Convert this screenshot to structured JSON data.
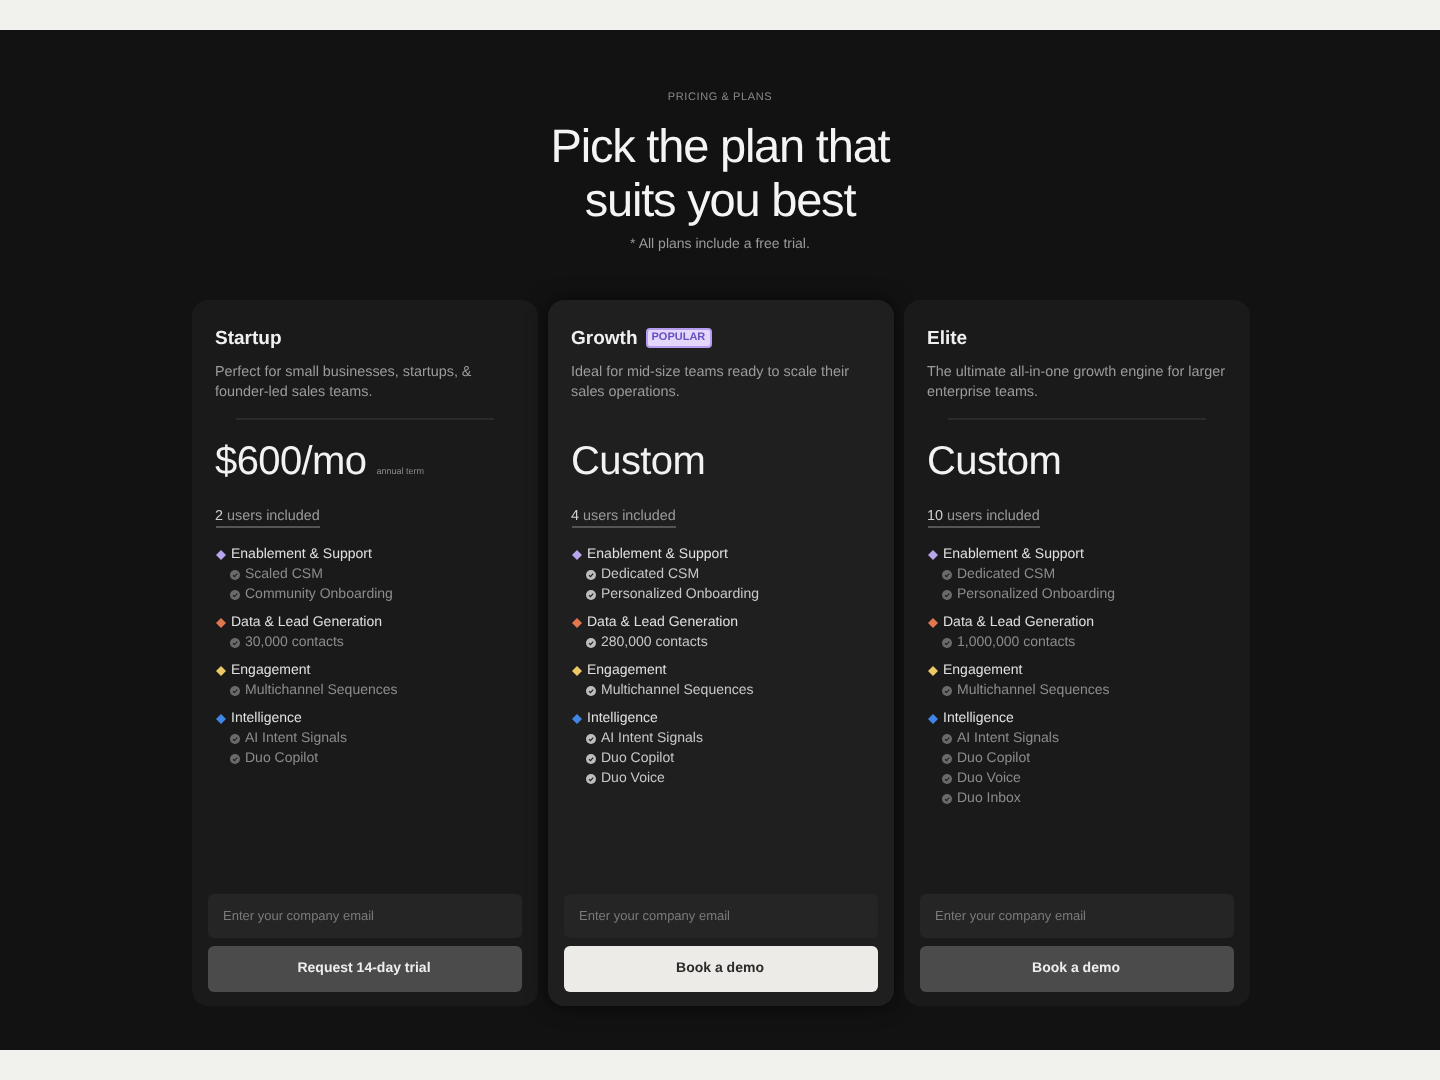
{
  "header": {
    "eyebrow": "PRICING & PLANS",
    "headline_lines": [
      "Pick the plan that",
      "suits you best"
    ],
    "note": "* All plans include a free trial."
  },
  "plans": [
    {
      "name": "Startup",
      "featured": false,
      "description": "Perfect for small businesses, startups, & founder-led sales teams.",
      "price": "$600/mo",
      "price_note": "annual term",
      "users": "**2** users included",
      "groups": [
        {
          "title": "Enablement & Support",
          "color": "#b6a4ec",
          "items": [
            "Scaled CSM",
            "Community Onboarding"
          ]
        },
        {
          "title": "Data & Lead Generation",
          "color": "#e0774f",
          "items": [
            "30,000 contacts"
          ]
        },
        {
          "title": "Engagement",
          "color": "#ecc866",
          "items": [
            "Multichannel Sequences"
          ]
        },
        {
          "title": "Intelligence",
          "color": "#3f86e6",
          "items": [
            "AI Intent Signals",
            "Duo Copilot"
          ]
        }
      ],
      "email_placeholder": "Enter your company email",
      "button": "Request 14-day trial"
    },
    {
      "name": "Growth",
      "badge": "POPULAR",
      "featured": true,
      "description": "Ideal for mid-size teams ready to scale their sales operations.",
      "price": "Custom",
      "users": "**4** users included",
      "groups": [
        {
          "title": "Enablement & Support",
          "color": "#b6a4ec",
          "items": [
            "Dedicated CSM",
            "Personalized Onboarding"
          ]
        },
        {
          "title": "Data & Lead Generation",
          "color": "#e0774f",
          "items": [
            "280,000 contacts"
          ]
        },
        {
          "title": "Engagement",
          "color": "#ecc866",
          "items": [
            "Multichannel Sequences"
          ]
        },
        {
          "title": "Intelligence",
          "color": "#3f86e6",
          "items": [
            "AI Intent Signals",
            "Duo Copilot",
            "Duo Voice"
          ]
        }
      ],
      "email_placeholder": "Enter your company email",
      "button": "Book a demo"
    },
    {
      "name": "Elite",
      "featured": false,
      "description": "The ultimate all-in-one growth engine for larger enterprise teams.",
      "price": "Custom",
      "users": "**10** users included",
      "groups": [
        {
          "title": "Enablement & Support",
          "color": "#b6a4ec",
          "items": [
            "Dedicated CSM",
            "Personalized Onboarding"
          ]
        },
        {
          "title": "Data & Lead Generation",
          "color": "#e0774f",
          "items": [
            "1,000,000 contacts"
          ]
        },
        {
          "title": "Engagement",
          "color": "#ecc866",
          "items": [
            "Multichannel Sequences"
          ]
        },
        {
          "title": "Intelligence",
          "color": "#3f86e6",
          "items": [
            "AI Intent Signals",
            "Duo Copilot",
            "Duo Voice",
            "Duo Inbox"
          ]
        }
      ],
      "email_placeholder": "Enter your company email",
      "button": "Book a demo"
    }
  ]
}
